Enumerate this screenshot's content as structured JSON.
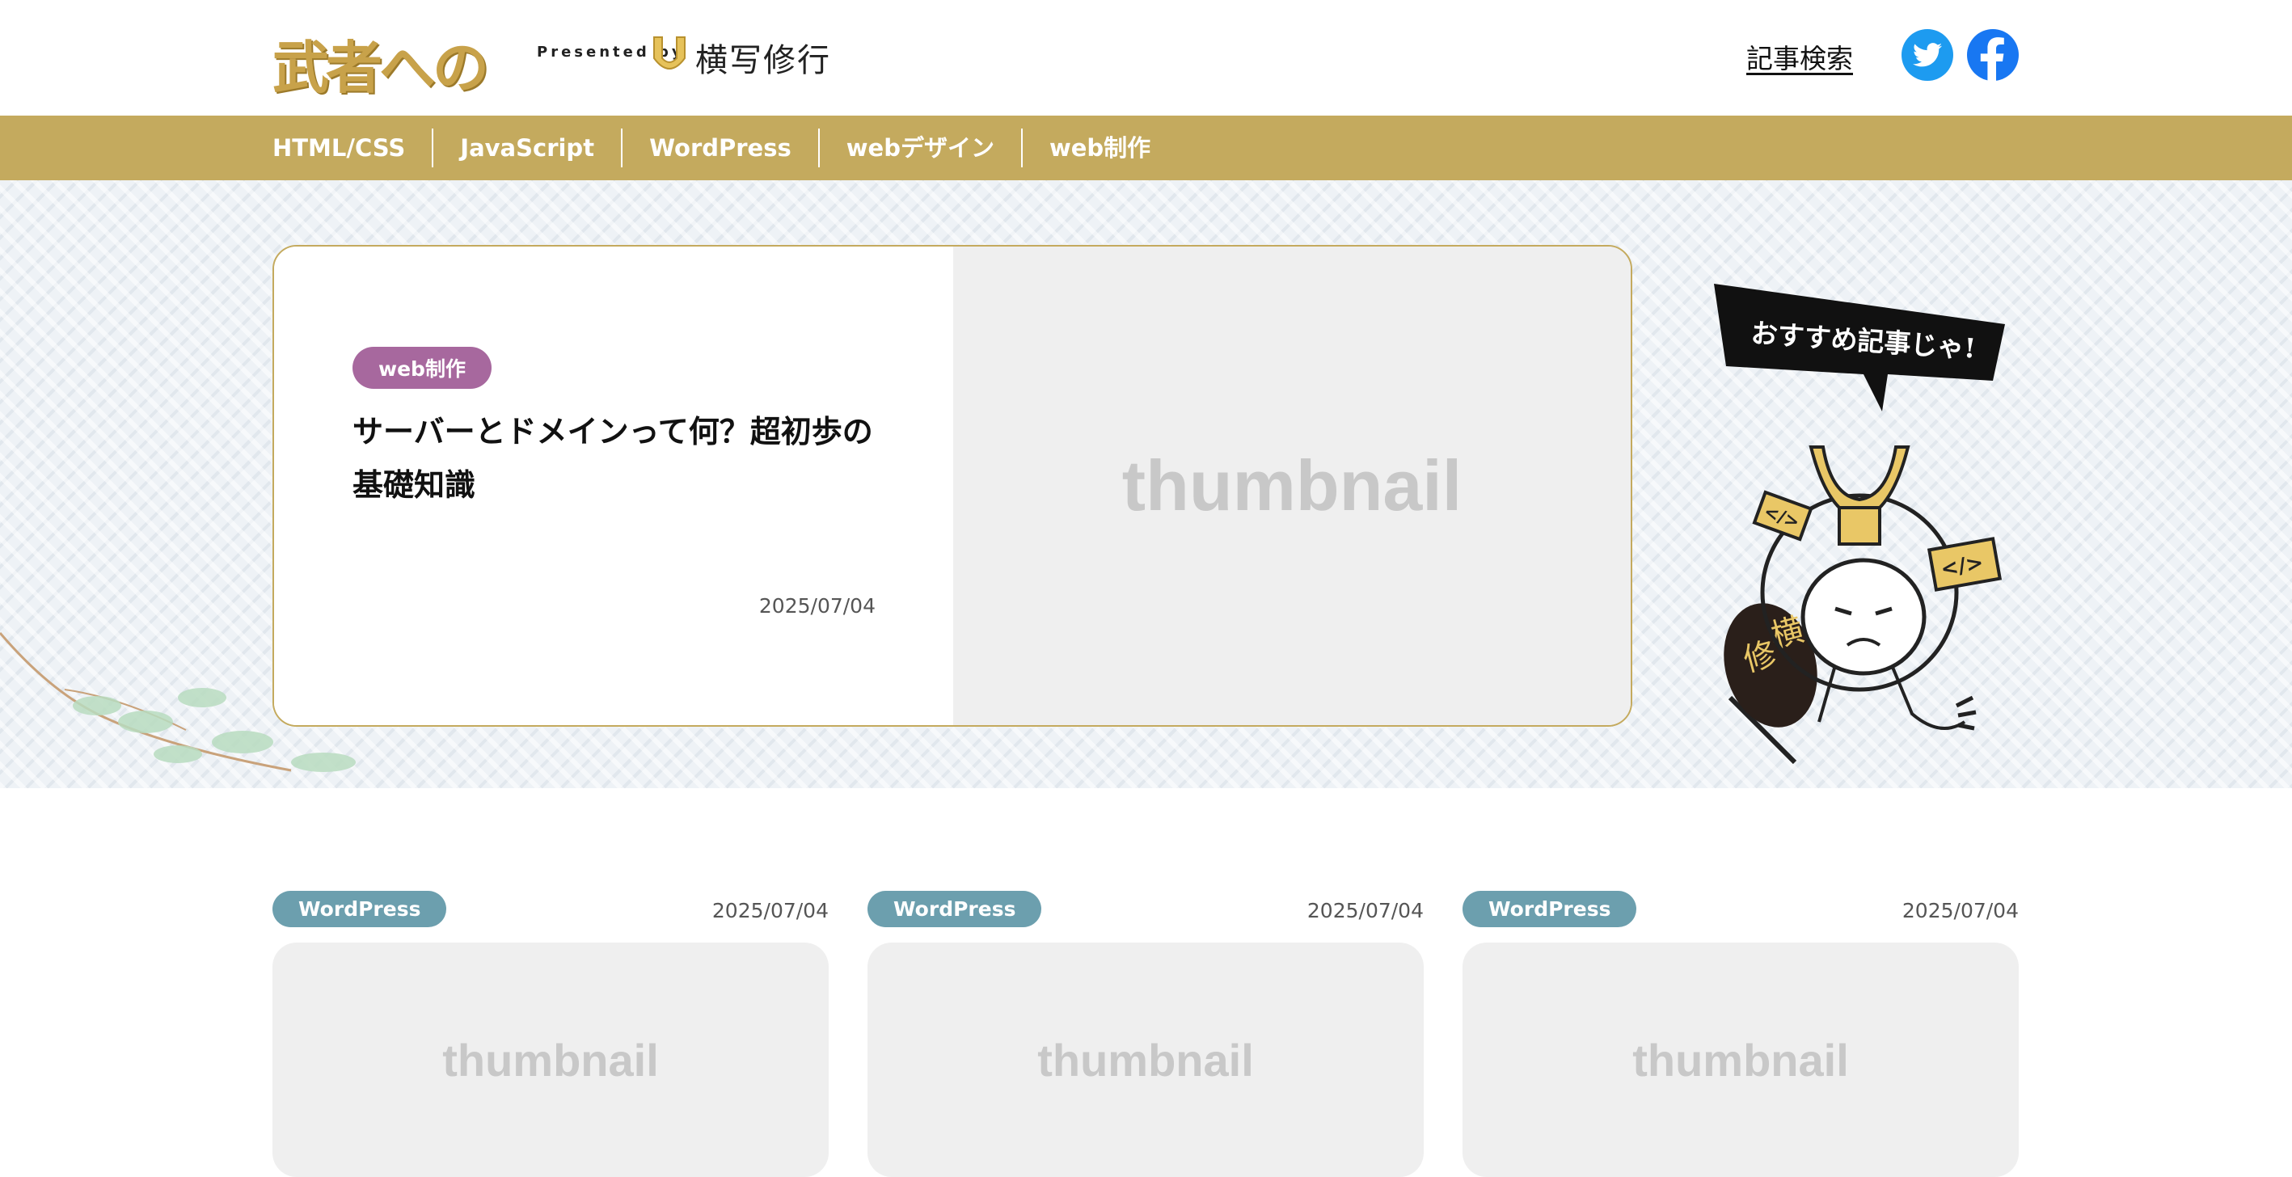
{
  "header": {
    "logo_text": "武者への道",
    "presented_by": "Presented by",
    "brand_name": "横写修行",
    "search_link": "記事検索",
    "social": [
      "twitter-icon",
      "facebook-icon"
    ]
  },
  "nav": {
    "items": [
      "HTML/CSS",
      "JavaScript",
      "WordPress",
      "webデザイン",
      "web制作"
    ]
  },
  "featured": {
    "category": "web制作",
    "title": "サーバーとドメインって何？超初歩の基礎知識",
    "date": "2025/07/04",
    "thumbnail_text": "thumbnail"
  },
  "mascot": {
    "bubble_text": "おすすめ記事じゃ!",
    "shield_text": "横写修行"
  },
  "articles": [
    {
      "category": "WordPress",
      "date": "2025/07/04",
      "thumbnail_text": "thumbnail"
    },
    {
      "category": "WordPress",
      "date": "2025/07/04",
      "thumbnail_text": "thumbnail"
    },
    {
      "category": "WordPress",
      "date": "2025/07/04",
      "thumbnail_text": "thumbnail"
    }
  ],
  "colors": {
    "nav_gold": "#c4aa5e",
    "web_pill": "#a7689e",
    "wordpress_pill": "#6c9fae",
    "twitter": "#1d9bf0",
    "facebook": "#1877f2"
  }
}
